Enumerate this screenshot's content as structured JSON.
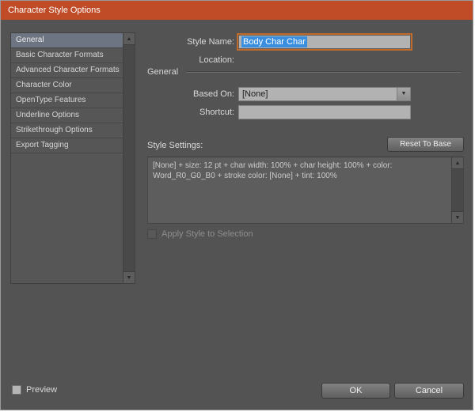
{
  "dialog": {
    "title": "Character Style Options"
  },
  "sidebar": {
    "items": [
      {
        "label": "General"
      },
      {
        "label": "Basic Character Formats"
      },
      {
        "label": "Advanced Character Formats"
      },
      {
        "label": "Character Color"
      },
      {
        "label": "OpenType Features"
      },
      {
        "label": "Underline Options"
      },
      {
        "label": "Strikethrough Options"
      },
      {
        "label": "Export Tagging"
      }
    ]
  },
  "form": {
    "style_name_label": "Style Name:",
    "style_name_value": "Body Char Char",
    "location_label": "Location:",
    "location_value": "",
    "section_title": "General",
    "based_on_label": "Based On:",
    "based_on_value": "[None]",
    "shortcut_label": "Shortcut:",
    "shortcut_value": "",
    "style_settings_label": "Style Settings:",
    "reset_to_base_label": "Reset To Base",
    "style_settings_text": "[None] + size: 12 pt + char width: 100% + char height: 100% + color: Word_R0_G0_B0 + stroke color: [None] + tint: 100%",
    "apply_style_label": "Apply Style to Selection"
  },
  "footer": {
    "preview_label": "Preview",
    "ok_label": "OK",
    "cancel_label": "Cancel"
  },
  "icons": {
    "scroll_up": "▲",
    "scroll_down": "▼",
    "dropdown_arrow": "▼"
  },
  "colors": {
    "titlebar": "#bf4b27",
    "dialog_bg": "#535353",
    "selected_item": "#6d7582",
    "selection_blue": "#3a8ede",
    "focus_orange": "#c06a2c"
  }
}
